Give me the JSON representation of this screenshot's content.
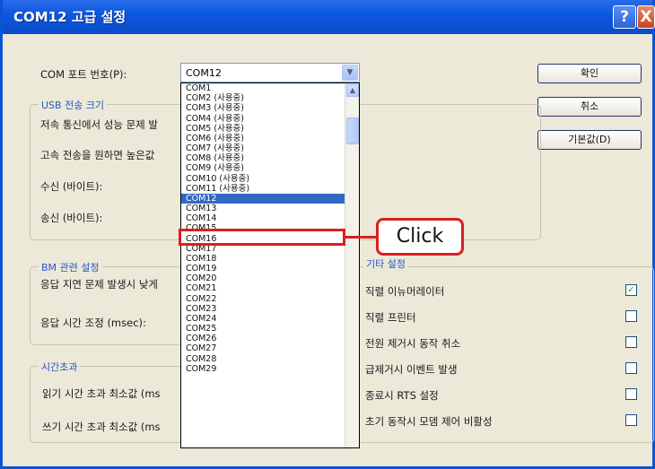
{
  "window": {
    "title": "COM12 고급 설정",
    "help_glyph": "?",
    "close_glyph": "X"
  },
  "port": {
    "label": "COM 포트 번호(P):",
    "value": "COM12",
    "arrow": "▼"
  },
  "buttons": {
    "ok": "확인",
    "cancel": "취소",
    "defaults": "기본값(D)"
  },
  "usb": {
    "title": "USB 전송 크기",
    "line1": "저속 통신에서 성능 문제 발",
    "line2": "고속 전송을 원하면 높은값",
    "receive": "수신 (바이트):",
    "transmit": "송신 (바이트):"
  },
  "bm": {
    "title": "BM 관련 설정",
    "line1": "응답 지연 문제 발생시 낮게",
    "latency": "응답 시간 조정 (msec):"
  },
  "timeouts": {
    "title": "시간초과",
    "read": "읽기 시간 초과 최소값 (ms",
    "write": "쓰기 시간 초과 최소값 (ms"
  },
  "misc": {
    "title": "기타 설정",
    "options": [
      {
        "label": "직렬 이뉴머레이터",
        "checked": "✓"
      },
      {
        "label": "직렬 프린터",
        "checked": ""
      },
      {
        "label": "전원 제거시 동작 취소",
        "checked": ""
      },
      {
        "label": "급제거시 이벤트 발생",
        "checked": ""
      },
      {
        "label": "종료시 RTS 설정",
        "checked": ""
      },
      {
        "label": "초기 동작시 모뎀 제어 비활성",
        "checked": ""
      }
    ]
  },
  "dropdown": {
    "items": [
      "COM1",
      "COM2 (사용중)",
      "COM3 (사용중)",
      "COM4 (사용중)",
      "COM5 (사용중)",
      "COM6 (사용중)",
      "COM7 (사용중)",
      "COM8 (사용중)",
      "COM9 (사용중)",
      "COM10 (사용중)",
      "COM11 (사용중)",
      "COM12",
      "COM13",
      "COM14",
      "COM15",
      "COM16",
      "COM17",
      "COM18",
      "COM19",
      "COM20",
      "COM21",
      "COM22",
      "COM23",
      "COM24",
      "COM25",
      "COM26",
      "COM27",
      "COM28",
      "COM29"
    ],
    "selected_index": 11,
    "scroll_up": "▲"
  },
  "callout": {
    "text": "Click"
  },
  "colors": {
    "title_bar": "#0c58e0",
    "selection": "#316ac5",
    "annotation": "#d9201f"
  }
}
